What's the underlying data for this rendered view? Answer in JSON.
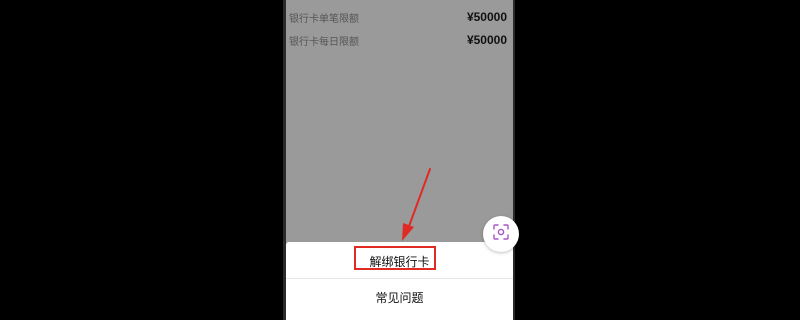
{
  "limits": {
    "single_label": "银行卡单笔限额",
    "single_value": "¥50000",
    "daily_label": "银行卡每日限额",
    "daily_value": "¥50000"
  },
  "action_sheet": {
    "unbind_label": "解绑银行卡",
    "faq_label": "常见问题"
  },
  "floating_button": {
    "icon": "scan-icon",
    "accent": "#a855c7"
  },
  "annotations": {
    "arrow_color": "#e02a24",
    "highlight_color": "#e02a24"
  }
}
